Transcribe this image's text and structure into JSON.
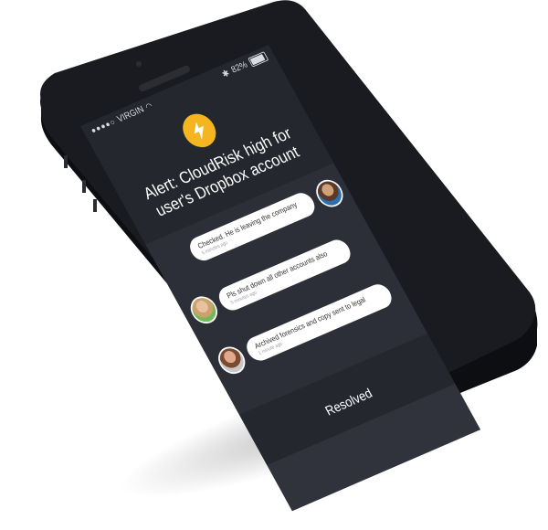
{
  "status": {
    "carrier": "VIRGIN",
    "battery": "82%",
    "battery_level": 0.82
  },
  "alert": {
    "icon": "lightning-bolt-icon",
    "title": "Alert: CloudRisk high for user's Dropbox account"
  },
  "messages": [
    {
      "text": "Checked. He is leaving the company",
      "time": "5 minutes ago"
    },
    {
      "text": "Pls shut down all other accounts also",
      "time": "5 minutes ago"
    },
    {
      "text": "Archived forensics and copy sent to legal",
      "time": "1 minute ago"
    }
  ],
  "actions": {
    "resolved_label": "Resolved"
  },
  "colors": {
    "accent": "#f4b521",
    "screen_bg": "#25272e"
  }
}
